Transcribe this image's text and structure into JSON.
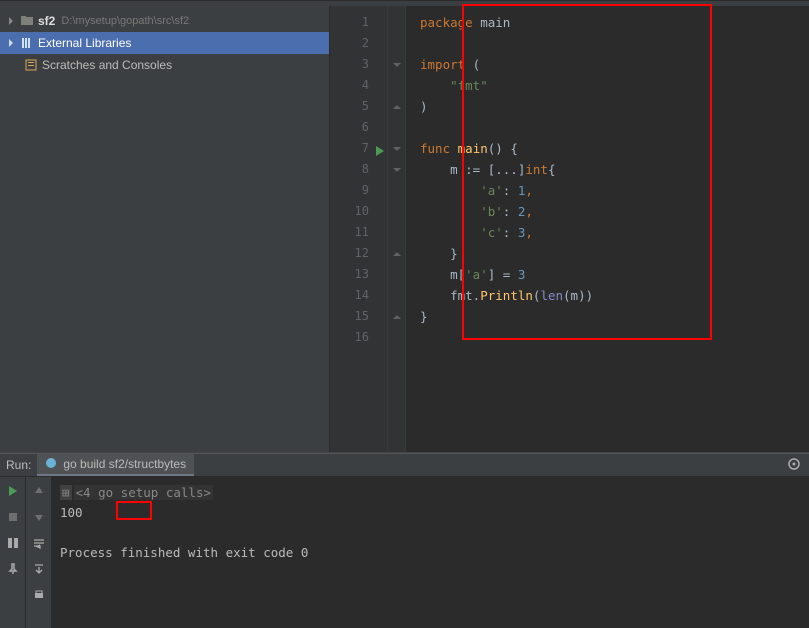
{
  "tree": {
    "root": {
      "label": "sf2",
      "hint": "D:\\mysetup\\gopath\\src\\sf2"
    },
    "ext": {
      "label": "External Libraries"
    },
    "scratches": {
      "label": "Scratches and Consoles"
    }
  },
  "editor": {
    "lines": [
      "1",
      "2",
      "3",
      "4",
      "5",
      "6",
      "7",
      "8",
      "9",
      "10",
      "11",
      "12",
      "13",
      "14",
      "15",
      "16"
    ],
    "code": {
      "l1_kw": "package",
      "l1_id": "main",
      "l3_kw": "import",
      "l3_op": " (",
      "l4_str": "\"fmt\"",
      "l5_cl": ")",
      "l7_kw": "func",
      "l7_fn": "main",
      "l7_sig": "() {",
      "l8_a": "    m := [...]",
      "l8_type": "int",
      "l8_b": "{",
      "l9_a": "        ",
      "l9_r": "'a'",
      "l9_b": ": ",
      "l9_n": "1",
      "l9_c": ",",
      "l10_a": "        ",
      "l10_r": "'b'",
      "l10_b": ": ",
      "l10_n": "2",
      "l10_c": ",",
      "l11_a": "        ",
      "l11_r": "'c'",
      "l11_b": ": ",
      "l11_n": "3",
      "l11_c": ",",
      "l12_a": "    }",
      "l13_a": "    m[",
      "l13_r": "'a'",
      "l13_b": "] = ",
      "l13_n": "3",
      "l14_a": "    fmt.",
      "l14_fn": "Println",
      "l14_b": "(",
      "l14_bi": "len",
      "l14_c": "(m))",
      "l15": "}"
    }
  },
  "run": {
    "label": "Run:",
    "tab": "go build sf2/structbytes",
    "fold": "<4 go setup calls>",
    "output": "100",
    "exitline": "Process finished with exit code 0"
  }
}
